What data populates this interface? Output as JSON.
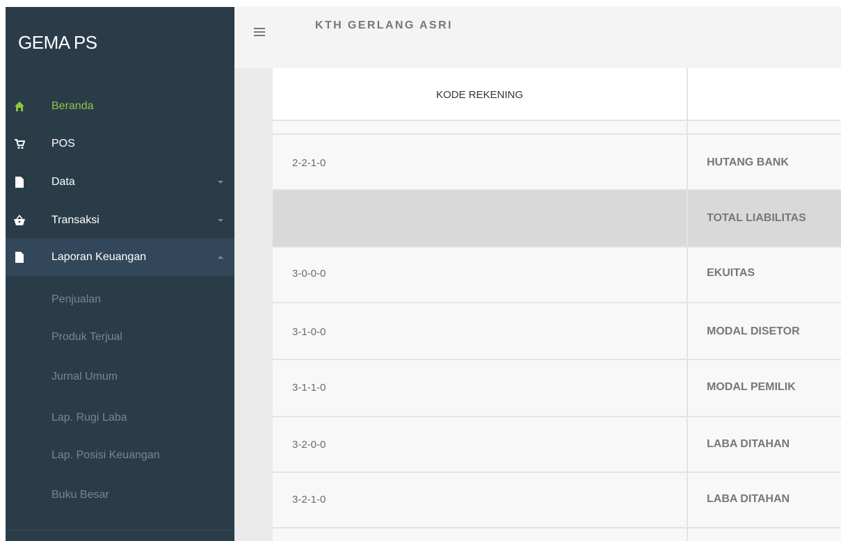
{
  "sidebar": {
    "brand": "GEMA PS",
    "items": [
      {
        "label": "Beranda",
        "color": "#8cc63f"
      },
      {
        "label": "POS"
      },
      {
        "label": "Data"
      },
      {
        "label": "Transaksi"
      },
      {
        "label": "Laporan Keuangan"
      }
    ],
    "subitems": [
      {
        "label": "Penjualan"
      },
      {
        "label": "Produk Terjual"
      },
      {
        "label": "Jurnal Umum"
      },
      {
        "label": "Lap. Rugi Laba"
      },
      {
        "label": "Lap. Posisi Keuangan"
      },
      {
        "label": "Buku Besar"
      }
    ]
  },
  "topbar": {
    "title": "KTH GERLANG ASRI",
    "menu_icon": "hamburger-icon"
  },
  "table": {
    "header": {
      "code": "KODE REKENING",
      "name": ""
    },
    "rows": [
      {
        "code": "2-2-1-0",
        "name": "HUTANG BANK"
      },
      {
        "code": "",
        "name": "TOTAL LIABILITAS"
      },
      {
        "code": "3-0-0-0",
        "name": "EKUITAS"
      },
      {
        "code": "3-1-0-0",
        "name": "MODAL DISETOR"
      },
      {
        "code": "3-1-1-0",
        "name": "MODAL PEMILIK"
      },
      {
        "code": "3-2-0-0",
        "name": "LABA DITAHAN"
      },
      {
        "code": "3-2-1-0",
        "name": "LABA DITAHAN"
      }
    ]
  },
  "colors": {
    "sidebar_bg": "#2b3c49",
    "active_green": "#8cc63f",
    "total_row_bg": "#d9d9d9"
  }
}
